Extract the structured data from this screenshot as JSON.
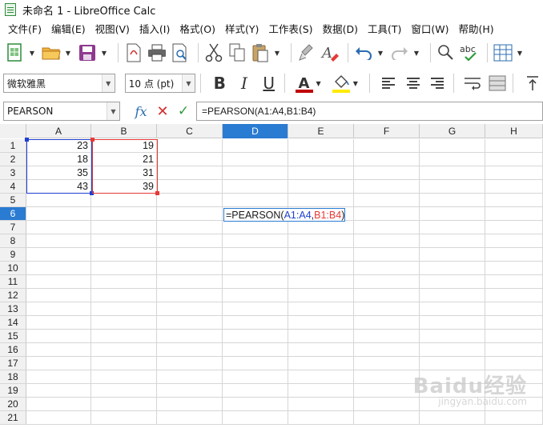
{
  "window": {
    "title": "未命名 1 - LibreOffice Calc"
  },
  "menu": [
    "文件(F)",
    "编辑(E)",
    "视图(V)",
    "插入(I)",
    "格式(O)",
    "样式(Y)",
    "工作表(S)",
    "数据(D)",
    "工具(T)",
    "窗口(W)",
    "帮助(H)"
  ],
  "formatting": {
    "font_name": "微软雅黑",
    "font_size": "10 点 (pt)",
    "bold_label": "B",
    "italic_label": "I",
    "underline_label": "U",
    "font_color_label": "A",
    "font_color": "#c00000",
    "highlight_color": "#ffeb00"
  },
  "formula_bar": {
    "name_box": "PEARSON",
    "fx_label": "fx",
    "cancel_label": "✕",
    "accept_label": "✓",
    "formula": "=PEARSON(A1:A4,B1:B4)"
  },
  "sheet": {
    "columns": [
      "A",
      "B",
      "C",
      "D",
      "E",
      "F",
      "G",
      "H"
    ],
    "active_column": "D",
    "active_row": 6,
    "row_count": 21,
    "cells": {
      "A1": "23",
      "A2": "18",
      "A3": "35",
      "A4": "43",
      "B1": "19",
      "B2": "21",
      "B3": "31",
      "B4": "39"
    },
    "edit_cell": {
      "ref": "D6",
      "prefix": "=PEARSON(",
      "range1": "A1:A4",
      "sep": ",",
      "range2": "B1:B4",
      "suffix": ")"
    },
    "range_colors": {
      "range1": "#1f3fd1",
      "range2": "#e53935"
    }
  },
  "watermark": {
    "main": "Baidu经验",
    "sub": "jingyan.baidu.com"
  }
}
